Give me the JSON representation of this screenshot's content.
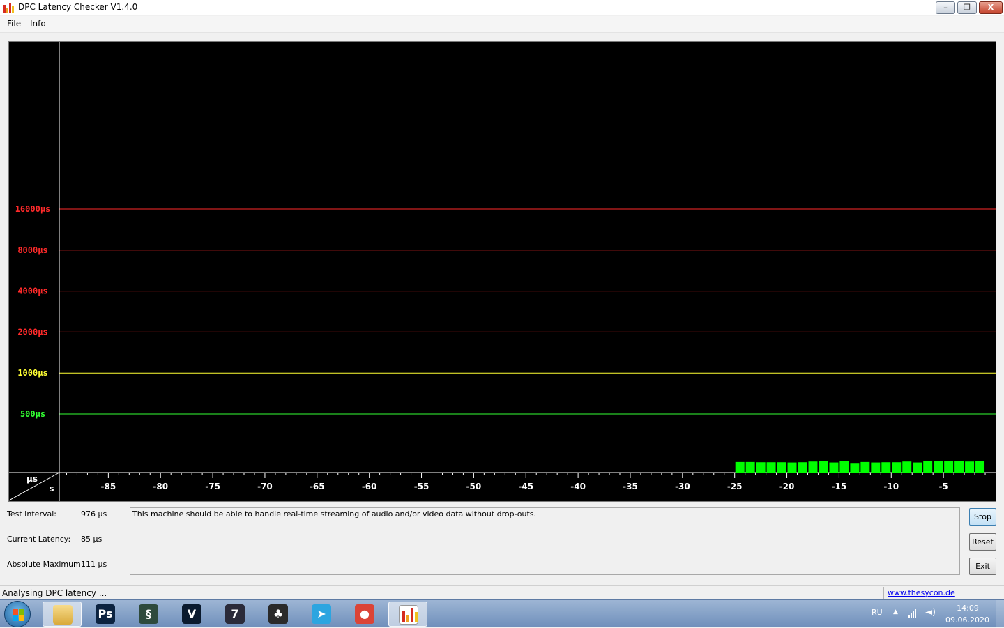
{
  "window": {
    "title": "DPC Latency Checker V1.4.0",
    "min_glyph": "–",
    "max_glyph": "❐",
    "close_glyph": "X"
  },
  "menu": [
    {
      "label": "File"
    },
    {
      "label": "Info"
    }
  ],
  "chart_data": {
    "type": "bar",
    "title": "",
    "xlabel": "s",
    "ylabel": "µs",
    "x_ticks": [
      -85,
      -80,
      -75,
      -70,
      -65,
      -60,
      -55,
      -50,
      -45,
      -40,
      -35,
      -30,
      -25,
      -20,
      -15,
      -10,
      -5
    ],
    "x_range": [
      -89.7,
      0
    ],
    "y_thresholds": [
      {
        "label": "16000µs",
        "value": 16000,
        "color": "#ff2a2a"
      },
      {
        "label": "8000µs",
        "value": 8000,
        "color": "#ff2a2a"
      },
      {
        "label": "4000µs",
        "value": 4000,
        "color": "#ff2a2a"
      },
      {
        "label": "2000µs",
        "value": 2000,
        "color": "#ff2a2a"
      },
      {
        "label": "1000µs",
        "value": 1000,
        "color": "#ffff33"
      },
      {
        "label": "500µs",
        "value": 500,
        "color": "#33ff33"
      }
    ],
    "bar_color": "#00ff00",
    "bar_x": [
      -24,
      -23,
      -22,
      -21,
      -20,
      -19,
      -18,
      -17,
      -16,
      -15,
      -14,
      -13,
      -12,
      -11,
      -10,
      -9,
      -8,
      -7,
      -6,
      -5,
      -4,
      -3,
      -2,
      -1
    ],
    "bar_values": [
      90,
      90,
      88,
      88,
      88,
      86,
      88,
      94,
      100,
      86,
      96,
      82,
      90,
      86,
      88,
      88,
      94,
      86,
      100,
      98,
      96,
      98,
      94,
      97
    ],
    "grid": true,
    "legend": "none"
  },
  "info": {
    "test_interval": {
      "label": "Test Interval:",
      "value": "976 µs"
    },
    "current_latency": {
      "label": "Current Latency:",
      "value": "85 µs"
    },
    "absolute_maximum": {
      "label": "Absolute Maximum:",
      "value": "111 µs"
    },
    "message": "This machine should be able to handle real-time streaming of audio and/or video data without drop-outs."
  },
  "buttons": {
    "stop": "Stop",
    "reset": "Reset",
    "exit": "Exit"
  },
  "status": {
    "text": "Analysing DPC latency ...",
    "link": "www.thesycon.de"
  },
  "taskbar": {
    "apps": [
      {
        "id": "explorer",
        "name": "folder-icon",
        "glyph": "",
        "color": "#e9c46a"
      },
      {
        "id": "photoshop",
        "name": "photoshop-icon",
        "glyph": "Ps",
        "color": "#0c2340"
      },
      {
        "id": "app3",
        "name": "spiral-app-icon",
        "glyph": "§",
        "color": "#2e4a3c"
      },
      {
        "id": "vegas",
        "name": "vegas-icon",
        "glyph": "V",
        "color": "#0a1a2e"
      },
      {
        "id": "app5",
        "name": "film-reel-icon",
        "glyph": "7",
        "color": "#2b2b3a"
      },
      {
        "id": "flstudio",
        "name": "fl-studio-icon",
        "glyph": "♣",
        "color": "#2a2a2a"
      },
      {
        "id": "telegram",
        "name": "telegram-icon",
        "glyph": "➤",
        "color": "#2ca5e0"
      },
      {
        "id": "chrome",
        "name": "chrome-icon",
        "glyph": "●",
        "color": "#db4437"
      },
      {
        "id": "dpc",
        "name": "dpc-checker-icon",
        "glyph": "",
        "color": "#ffffff"
      }
    ],
    "tray": {
      "lang": "RU",
      "arrow": "▲",
      "volume": "◄)",
      "time": "14:09",
      "date": "09.06.2020"
    }
  }
}
